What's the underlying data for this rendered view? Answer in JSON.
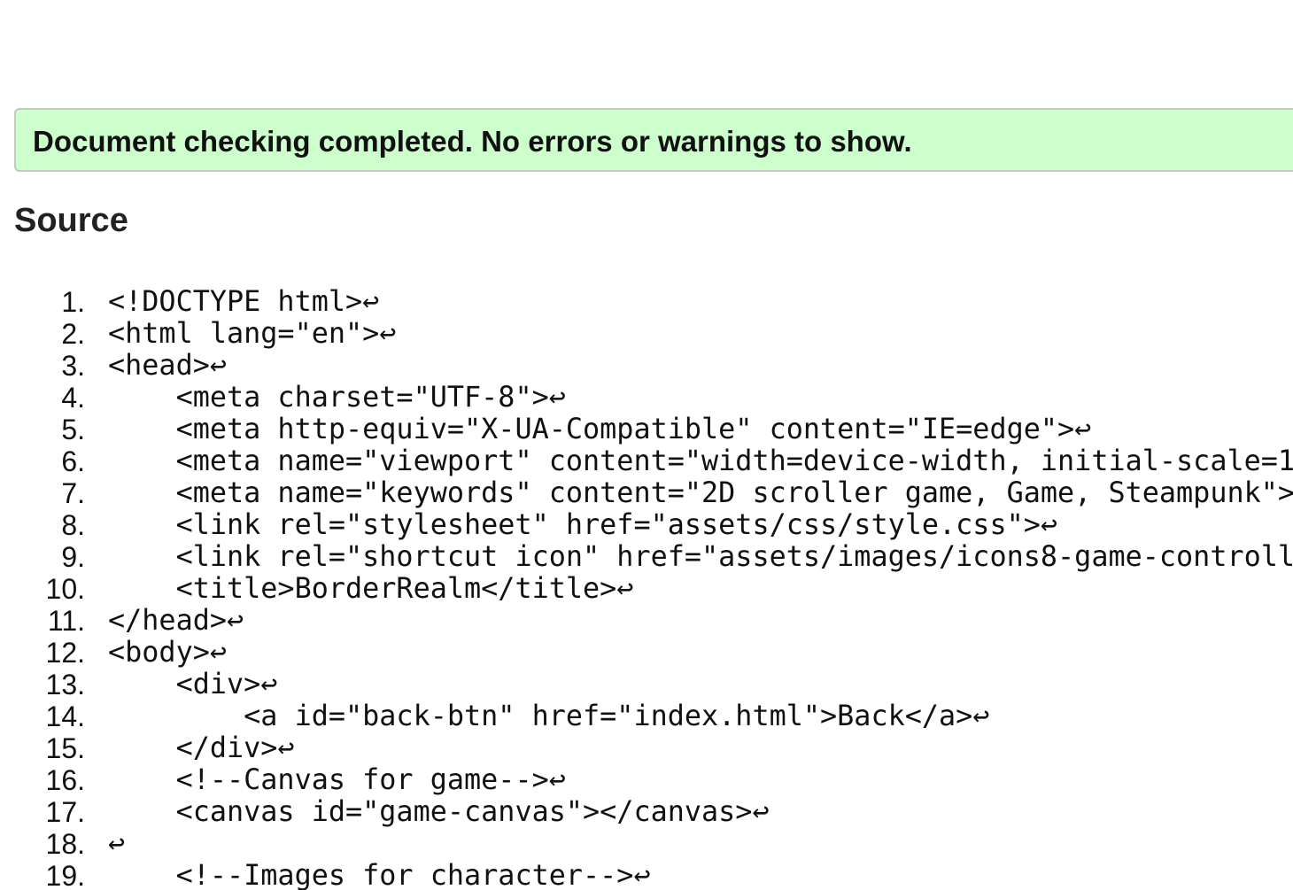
{
  "status": {
    "message": "Document checking completed. No errors or warnings to show."
  },
  "source": {
    "heading": "Source",
    "lines": [
      {
        "number": "1.",
        "code": "<!DOCTYPE html>↩"
      },
      {
        "number": "2.",
        "code": "<html lang=\"en\">↩"
      },
      {
        "number": "3.",
        "code": "<head>↩"
      },
      {
        "number": "4.",
        "code": "    <meta charset=\"UTF-8\">↩"
      },
      {
        "number": "5.",
        "code": "    <meta http-equiv=\"X-UA-Compatible\" content=\"IE=edge\">↩"
      },
      {
        "number": "6.",
        "code": "    <meta name=\"viewport\" content=\"width=device-width, initial-scale=1"
      },
      {
        "number": "7.",
        "code": "    <meta name=\"keywords\" content=\"2D scroller game, Game, Steampunk\">"
      },
      {
        "number": "8.",
        "code": "    <link rel=\"stylesheet\" href=\"assets/css/style.css\">↩"
      },
      {
        "number": "9.",
        "code": "    <link rel=\"shortcut icon\" href=\"assets/images/icons8-game-controll"
      },
      {
        "number": "10.",
        "code": "    <title>BorderRealm</title>↩"
      },
      {
        "number": "11.",
        "code": "</head>↩"
      },
      {
        "number": "12.",
        "code": "<body>↩"
      },
      {
        "number": "13.",
        "code": "    <div>↩"
      },
      {
        "number": "14.",
        "code": "        <a id=\"back-btn\" href=\"index.html\">Back</a>↩"
      },
      {
        "number": "15.",
        "code": "    </div>↩"
      },
      {
        "number": "16.",
        "code": "    <!--Canvas for game-->↩"
      },
      {
        "number": "17.",
        "code": "    <canvas id=\"game-canvas\"></canvas>↩"
      },
      {
        "number": "18.",
        "code": "↩"
      },
      {
        "number": "19.",
        "code": "    <!--Images for character-->↩"
      }
    ]
  },
  "colors": {
    "success_background": "#ccffcc",
    "success_border": "#c6c6c6"
  }
}
